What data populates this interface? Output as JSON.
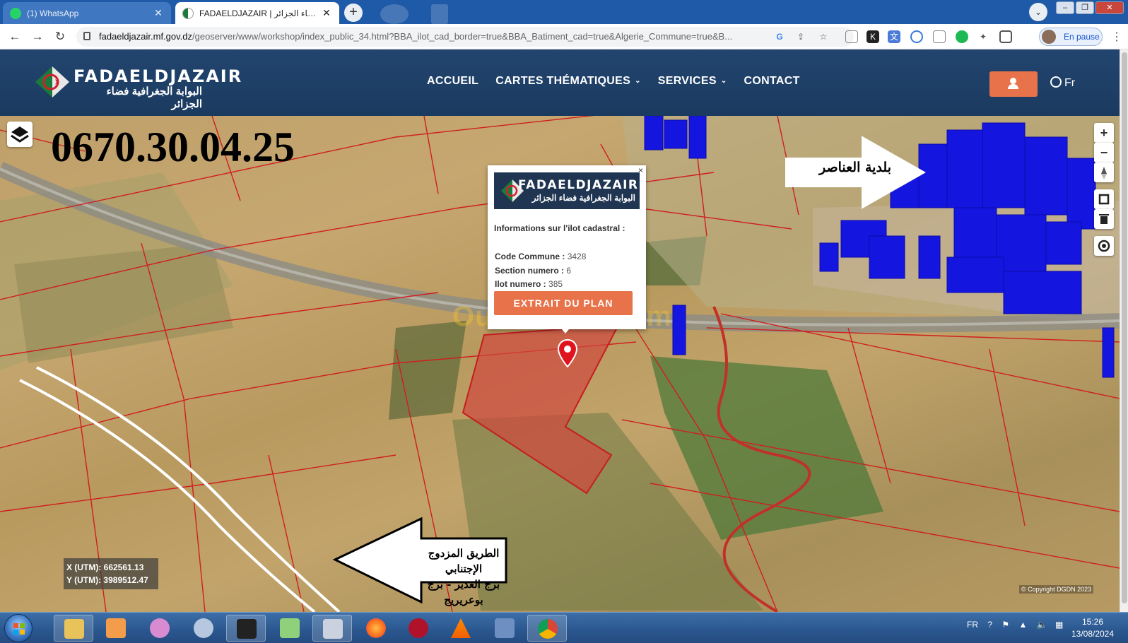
{
  "browser": {
    "tabs": [
      {
        "title": "(1) WhatsApp",
        "active": false
      },
      {
        "title": "FADAELDJAZAIR | البوابة الجغرافية فضاء الجزائر",
        "active": true
      }
    ],
    "url_host": "fadaeldjazair.mf.gov.dz",
    "url_path": "/geoserver/www/workshop/index_public_34.html?BBA_ilot_cad_border=true&BBA_Batiment_cad=true&Algerie_Commune=true&B...",
    "profile_label": "En pause"
  },
  "site": {
    "logo_name": "FADAELDJAZAIR",
    "logo_sub": "البوابة الجغرافية فضاء الجزائر",
    "nav": [
      {
        "label": "ACCUEIL",
        "dropdown": false
      },
      {
        "label": "CARTES THÉMATIQUES",
        "dropdown": true
      },
      {
        "label": "SERVICES",
        "dropdown": true
      },
      {
        "label": "CONTACT",
        "dropdown": false
      }
    ],
    "lang": "Fr",
    "accent": "#e8734a",
    "header_bg": "#1f416b"
  },
  "map": {
    "phone_overlay": "0670.30.04.25",
    "label_commune": "بلدية العناصر",
    "label_road_line1": "الطريق المزدوج الإجتنابي",
    "label_road_line2": "برج الغدير - برج بوعريريج",
    "watermark": "Ouedkniss.com",
    "coord_x": "X (UTM): 662561.13",
    "coord_y": "Y (UTM): 3989512.47",
    "copyright": "© Copyright DGDN 2023",
    "controls": [
      "zoom-in",
      "zoom-out",
      "compass",
      "draw",
      "delete",
      "locate"
    ],
    "zoom_in_label": "+",
    "zoom_out_label": "−"
  },
  "popup": {
    "close": "×",
    "heading": "Informations sur l'ilot cadastral :",
    "rows": [
      {
        "label": "Code Commune :",
        "value": "3428"
      },
      {
        "label": "Section numero :",
        "value": "6"
      },
      {
        "label": "Ilot numero :",
        "value": "385"
      }
    ],
    "button": "EXTRAIT DU PLAN"
  },
  "taskbar": {
    "lang": "FR",
    "time": "15:26",
    "date": "13/08/2024"
  }
}
